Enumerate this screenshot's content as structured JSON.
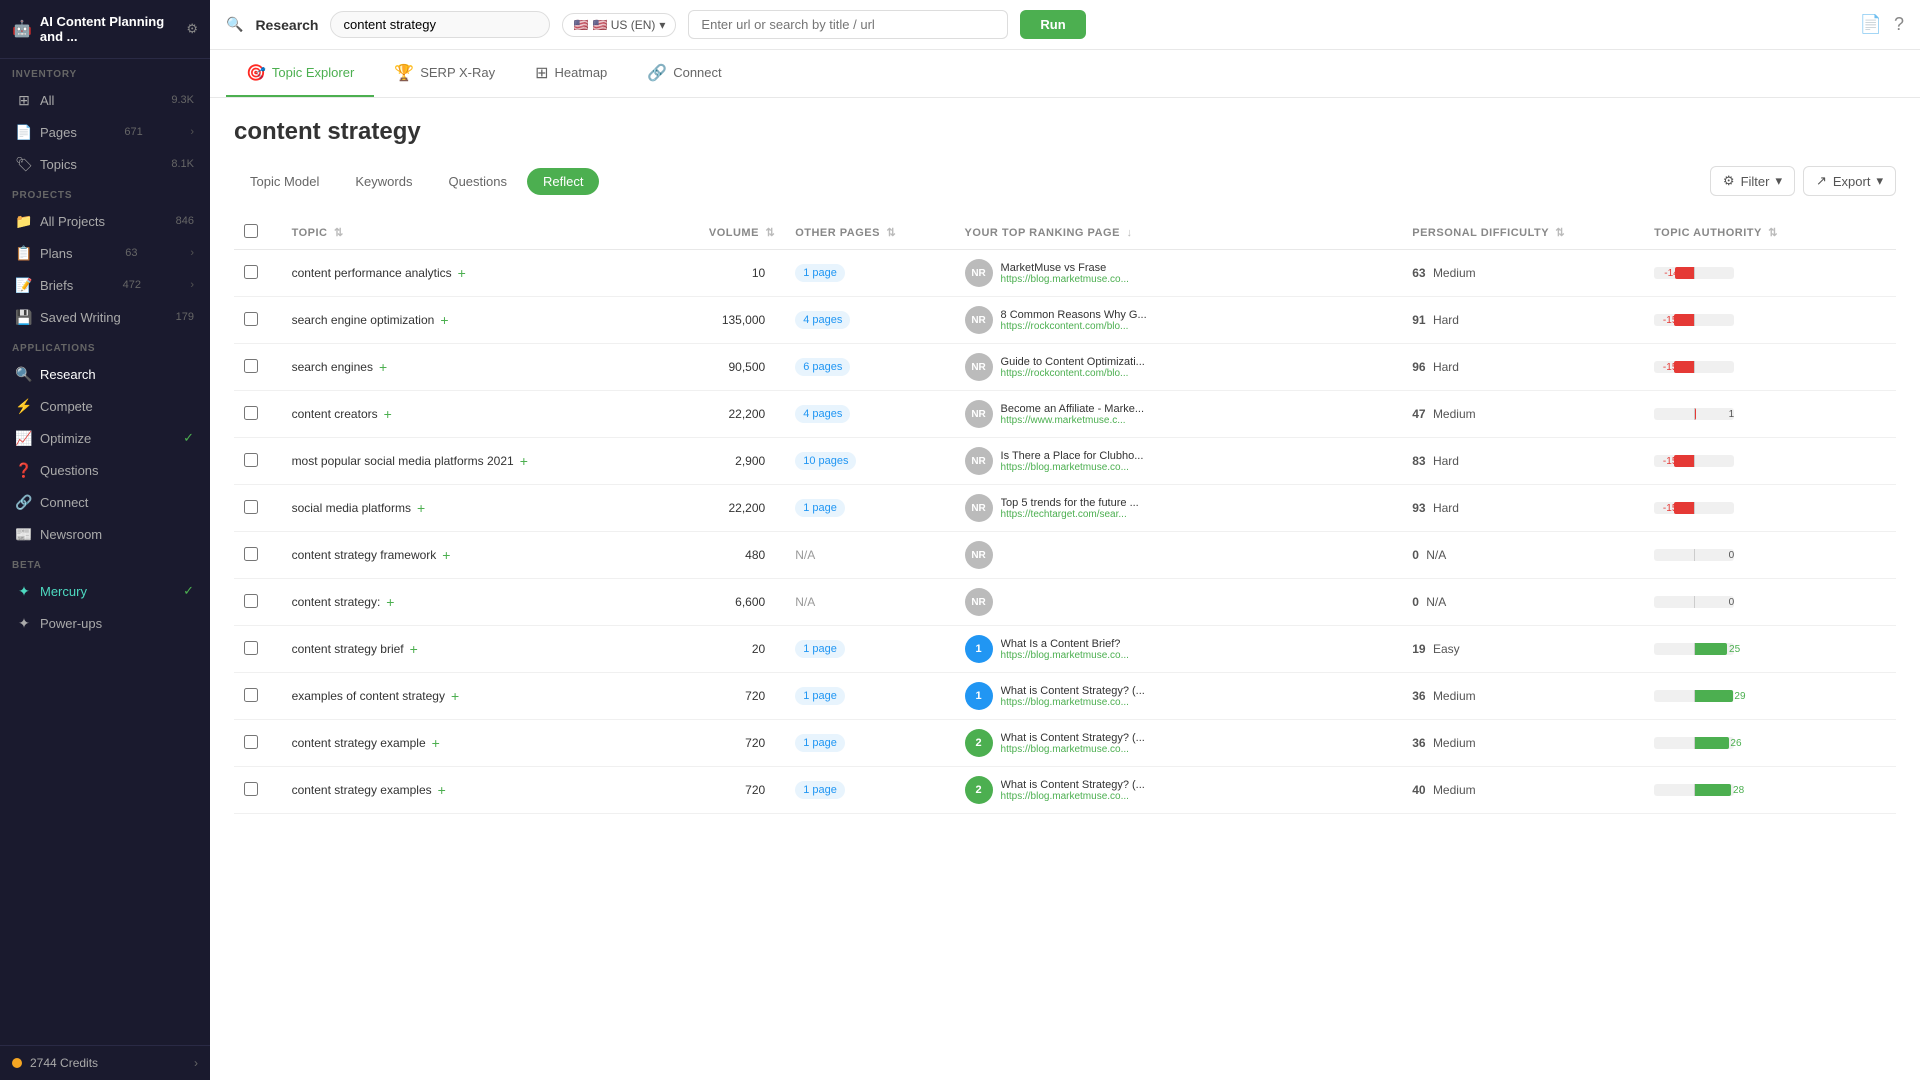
{
  "sidebar": {
    "app_title": "AI Content Planning and ...",
    "settings_icon": "⚙",
    "inventory": {
      "section_label": "INVENTORY",
      "items": [
        {
          "id": "all",
          "icon": "⊞",
          "label": "All",
          "badge": "9.3K"
        },
        {
          "id": "pages",
          "icon": "📄",
          "label": "Pages",
          "badge": "671",
          "arrow": true
        },
        {
          "id": "topics",
          "icon": "🏷",
          "label": "Topics",
          "badge": "8.1K"
        }
      ]
    },
    "projects": {
      "section_label": "PROJECTS",
      "items": [
        {
          "id": "all-projects",
          "icon": "📁",
          "label": "All Projects",
          "badge": "846"
        },
        {
          "id": "plans",
          "icon": "📋",
          "label": "Plans",
          "badge": "63",
          "arrow": true
        },
        {
          "id": "briefs",
          "icon": "📝",
          "label": "Briefs",
          "badge": "472",
          "arrow": true
        },
        {
          "id": "saved-writing",
          "icon": "💾",
          "label": "Saved Writing",
          "badge": "179"
        }
      ]
    },
    "applications": {
      "section_label": "APPLICATIONS",
      "items": [
        {
          "id": "research",
          "icon": "🔍",
          "label": "Research",
          "active": true
        },
        {
          "id": "compete",
          "icon": "⚡",
          "label": "Compete"
        },
        {
          "id": "optimize",
          "icon": "📈",
          "label": "Optimize",
          "check": true
        },
        {
          "id": "questions",
          "icon": "❓",
          "label": "Questions"
        },
        {
          "id": "connect",
          "icon": "🔗",
          "label": "Connect"
        },
        {
          "id": "newsroom",
          "icon": "📰",
          "label": "Newsroom"
        }
      ]
    },
    "beta": {
      "section_label": "BETA",
      "items": [
        {
          "id": "mercury",
          "icon": "✦",
          "label": "Mercury",
          "active": true,
          "check": true
        },
        {
          "id": "power-ups",
          "icon": "✦",
          "label": "Power-ups"
        }
      ]
    },
    "credits": {
      "label": "2744 Credits",
      "arrow": "›"
    }
  },
  "topnav": {
    "section": "Research",
    "search_value": "content strategy",
    "flag": "🇺🇸 US (EN)",
    "url_placeholder": "Enter url or search by title / url",
    "run_label": "Run",
    "doc_icon": "📄",
    "help_icon": "?"
  },
  "tabs": [
    {
      "id": "topic-explorer",
      "icon": "🎯",
      "label": "Topic Explorer",
      "active": true
    },
    {
      "id": "serp-x-ray",
      "icon": "🏆",
      "label": "SERP X-Ray"
    },
    {
      "id": "heatmap",
      "icon": "⊞",
      "label": "Heatmap"
    },
    {
      "id": "connect",
      "icon": "🔗",
      "label": "Connect"
    }
  ],
  "content": {
    "title": "content strategy",
    "sub_tabs": [
      {
        "id": "topic-model",
        "icon": "⊞",
        "label": "Topic Model"
      },
      {
        "id": "keywords",
        "label": "Keywords"
      },
      {
        "id": "questions",
        "label": "Questions"
      },
      {
        "id": "reflect",
        "label": "Reflect",
        "active": true
      }
    ],
    "filter_label": "Filter",
    "export_label": "Export",
    "table": {
      "headers": [
        {
          "id": "topic",
          "label": "TOPIC"
        },
        {
          "id": "volume",
          "label": "VOLUME"
        },
        {
          "id": "other-pages",
          "label": "OTHER PAGES"
        },
        {
          "id": "ranking",
          "label": "YOUR TOP RANKING PAGE"
        },
        {
          "id": "difficulty",
          "label": "PERSONAL DIFFICULTY"
        },
        {
          "id": "authority",
          "label": "TOPIC AUTHORITY"
        }
      ],
      "rows": [
        {
          "topic": "content performance analytics",
          "has_plus": true,
          "volume": "10",
          "other_pages": "1 page",
          "rank_avatar": "NR",
          "rank_type": "nr",
          "ranking_title": "MarketMuse vs Frase",
          "ranking_url": "https://blog.marketmuse.co...",
          "diff_score": "63",
          "diff_label": "Medium",
          "authority_value": -14,
          "bar_type": "negative"
        },
        {
          "topic": "search engine optimization",
          "has_plus": true,
          "volume": "135,000",
          "other_pages": "4 pages",
          "rank_avatar": "NR",
          "rank_type": "nr",
          "ranking_title": "8 Common Reasons Why G...",
          "ranking_url": "https://rockcontent.com/blo...",
          "diff_score": "91",
          "diff_label": "Hard",
          "authority_value": -15,
          "bar_type": "negative"
        },
        {
          "topic": "search engines",
          "has_plus": true,
          "volume": "90,500",
          "other_pages": "6 pages",
          "rank_avatar": "NR",
          "rank_type": "nr",
          "ranking_title": "Guide to Content Optimizati...",
          "ranking_url": "https://rockcontent.com/blo...",
          "diff_score": "96",
          "diff_label": "Hard",
          "authority_value": -15,
          "bar_type": "negative"
        },
        {
          "topic": "content creators",
          "has_plus": true,
          "volume": "22,200",
          "other_pages": "4 pages",
          "rank_avatar": "NR",
          "rank_type": "nr",
          "ranking_title": "Become an Affiliate - Marke...",
          "ranking_url": "https://www.marketmuse.c...",
          "diff_score": "47",
          "diff_label": "Medium",
          "authority_value": 1,
          "bar_type": "slight-positive"
        },
        {
          "topic": "most popular social media platforms 2021",
          "has_plus": true,
          "volume": "2,900",
          "other_pages": "10 pages",
          "rank_avatar": "NR",
          "rank_type": "nr",
          "ranking_title": "Is There a Place for Clubho...",
          "ranking_url": "https://blog.marketmuse.co...",
          "diff_score": "83",
          "diff_label": "Hard",
          "authority_value": -15,
          "bar_type": "negative"
        },
        {
          "topic": "social media platforms",
          "has_plus": true,
          "volume": "22,200",
          "other_pages": "1 page",
          "rank_avatar": "NR",
          "rank_type": "nr",
          "ranking_title": "Top 5 trends for the future ...",
          "ranking_url": "https://techtarget.com/sear...",
          "diff_score": "93",
          "diff_label": "Hard",
          "authority_value": -15,
          "bar_type": "negative"
        },
        {
          "topic": "content strategy framework",
          "has_plus": true,
          "volume": "480",
          "other_pages": "N/A",
          "rank_avatar": "NR",
          "rank_type": "nr",
          "ranking_title": "",
          "ranking_url": "",
          "diff_score": "0",
          "diff_label": "N/A",
          "authority_value": 0,
          "bar_type": "zero"
        },
        {
          "topic": "content strategy:",
          "has_plus": true,
          "volume": "6,600",
          "other_pages": "N/A",
          "rank_avatar": "NR",
          "rank_type": "nr",
          "ranking_title": "",
          "ranking_url": "",
          "diff_score": "0",
          "diff_label": "N/A",
          "authority_value": 0,
          "bar_type": "zero"
        },
        {
          "topic": "content strategy brief",
          "has_plus": true,
          "volume": "20",
          "other_pages": "1 page",
          "rank_avatar": "1",
          "rank_type": "rank-1",
          "ranking_title": "What Is a Content Brief?",
          "ranking_url": "https://blog.marketmuse.co...",
          "diff_score": "19",
          "diff_label": "Easy",
          "authority_value": 25,
          "bar_type": "positive"
        },
        {
          "topic": "examples of content strategy",
          "has_plus": true,
          "volume": "720",
          "other_pages": "1 page",
          "rank_avatar": "1",
          "rank_type": "rank-1",
          "ranking_title": "What is Content Strategy? (...",
          "ranking_url": "https://blog.marketmuse.co...",
          "diff_score": "36",
          "diff_label": "Medium",
          "authority_value": 29,
          "bar_type": "positive"
        },
        {
          "topic": "content strategy example",
          "has_plus": true,
          "volume": "720",
          "other_pages": "1 page",
          "rank_avatar": "2",
          "rank_type": "rank-2",
          "ranking_title": "What is Content Strategy? (...",
          "ranking_url": "https://blog.marketmuse.co...",
          "diff_score": "36",
          "diff_label": "Medium",
          "authority_value": 26,
          "bar_type": "positive"
        },
        {
          "topic": "content strategy examples",
          "has_plus": true,
          "volume": "720",
          "other_pages": "1 page",
          "rank_avatar": "2",
          "rank_type": "rank-2",
          "ranking_title": "What is Content Strategy? (...",
          "ranking_url": "https://blog.marketmuse.co...",
          "diff_score": "40",
          "diff_label": "Medium",
          "authority_value": 28,
          "bar_type": "positive"
        }
      ]
    }
  }
}
